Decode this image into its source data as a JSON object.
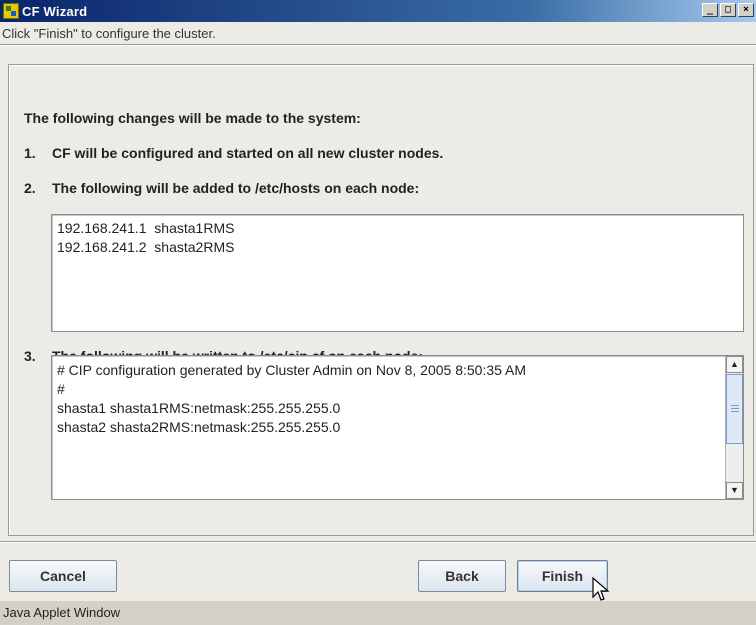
{
  "window": {
    "title": "CF Wizard",
    "icon": "cluster-app-icon",
    "controls": {
      "minimize": "_",
      "maximize": "□",
      "close": "×"
    }
  },
  "hint": "Click \"Finish\" to configure the cluster.",
  "heading": "The following changes will be made to the system:",
  "steps": [
    {
      "num": "1.",
      "text": "CF will be configured and started on all new cluster nodes."
    },
    {
      "num": "2.",
      "text": "The following will be added to /etc/hosts on each node:"
    },
    {
      "num": "3.",
      "text": "The following will be written to /etc/cip.cf on each node:"
    }
  ],
  "hosts_lines": [
    "192.168.241.1  shasta1RMS",
    "192.168.241.2  shasta2RMS"
  ],
  "cip_lines": [
    "# CIP configuration generated by Cluster Admin on Nov 8, 2005 8:50:35 AM",
    "#",
    "shasta1 shasta1RMS:netmask:255.255.255.0",
    "shasta2 shasta2RMS:netmask:255.255.255.0"
  ],
  "buttons": {
    "cancel": "Cancel",
    "back": "Back",
    "finish": "Finish"
  },
  "status_bar": "Java Applet Window",
  "colors": {
    "titlebar_start": "#0a246a",
    "titlebar_end": "#a6caf0",
    "background": "#ecebe6"
  }
}
